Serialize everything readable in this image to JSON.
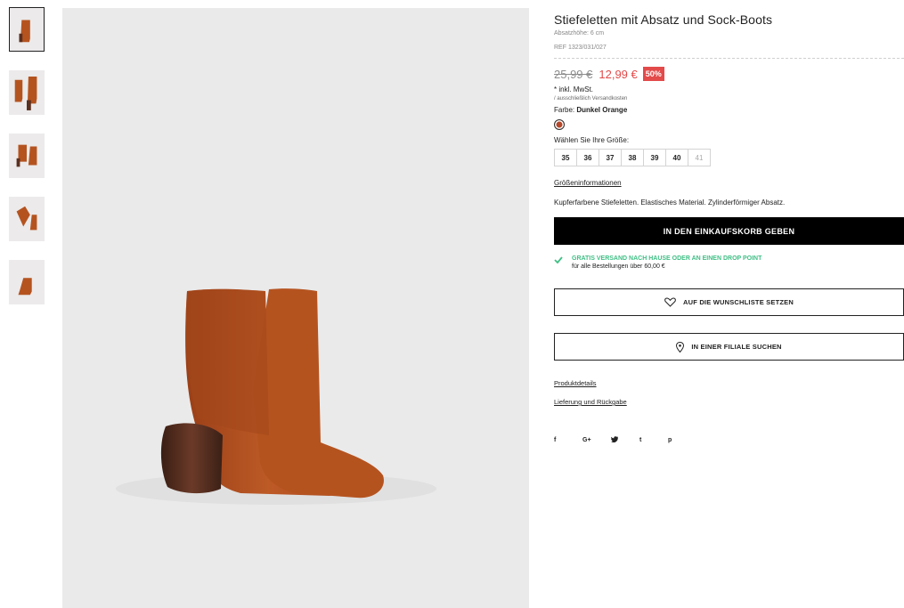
{
  "product": {
    "title": "Stiefeletten mit Absatz und Sock-Boots",
    "heel_height": "Absatzhöhe: 6 cm",
    "ref": "REF 1323/031/027",
    "old_price": "25,99 €",
    "new_price": "12,99 €",
    "discount": "50%",
    "tax_note": "* inkl. MwSt.",
    "shipping_note": "/ ausschließlich Versandkosten",
    "color_label": "Farbe:",
    "color_name": "Dunkel Orange",
    "color_hex": "#b5482a",
    "size_prompt": "Wählen Sie Ihre Größe:",
    "sizes": [
      "35",
      "36",
      "37",
      "38",
      "39",
      "40",
      "41"
    ],
    "size_info_link": "Größeninformationen",
    "description": "Kupferfarbene Stiefeletten. Elastisches Material. Zylinderförmiger Absatz."
  },
  "actions": {
    "add_to_cart": "IN DEN EINKAUFSKORB GEBEN",
    "wishlist": "AUF DIE WUNSCHLISTE SETZEN",
    "find_store": "IN EINER FILIALE SUCHEN"
  },
  "shipping": {
    "headline": "GRATIS VERSAND NACH HAUSE ODER AN EINEN DROP POINT",
    "subline": "für alle Bestellungen über 60,00 €"
  },
  "links": {
    "product_details": "Produktdetails",
    "delivery_returns": "Lieferung und Rückgabe"
  },
  "social": [
    "f",
    "G+",
    "t",
    "p"
  ],
  "colors": {
    "accent_red": "#e34a4a",
    "accent_green": "#3fbf85",
    "boot_orange": "#b5531f"
  }
}
